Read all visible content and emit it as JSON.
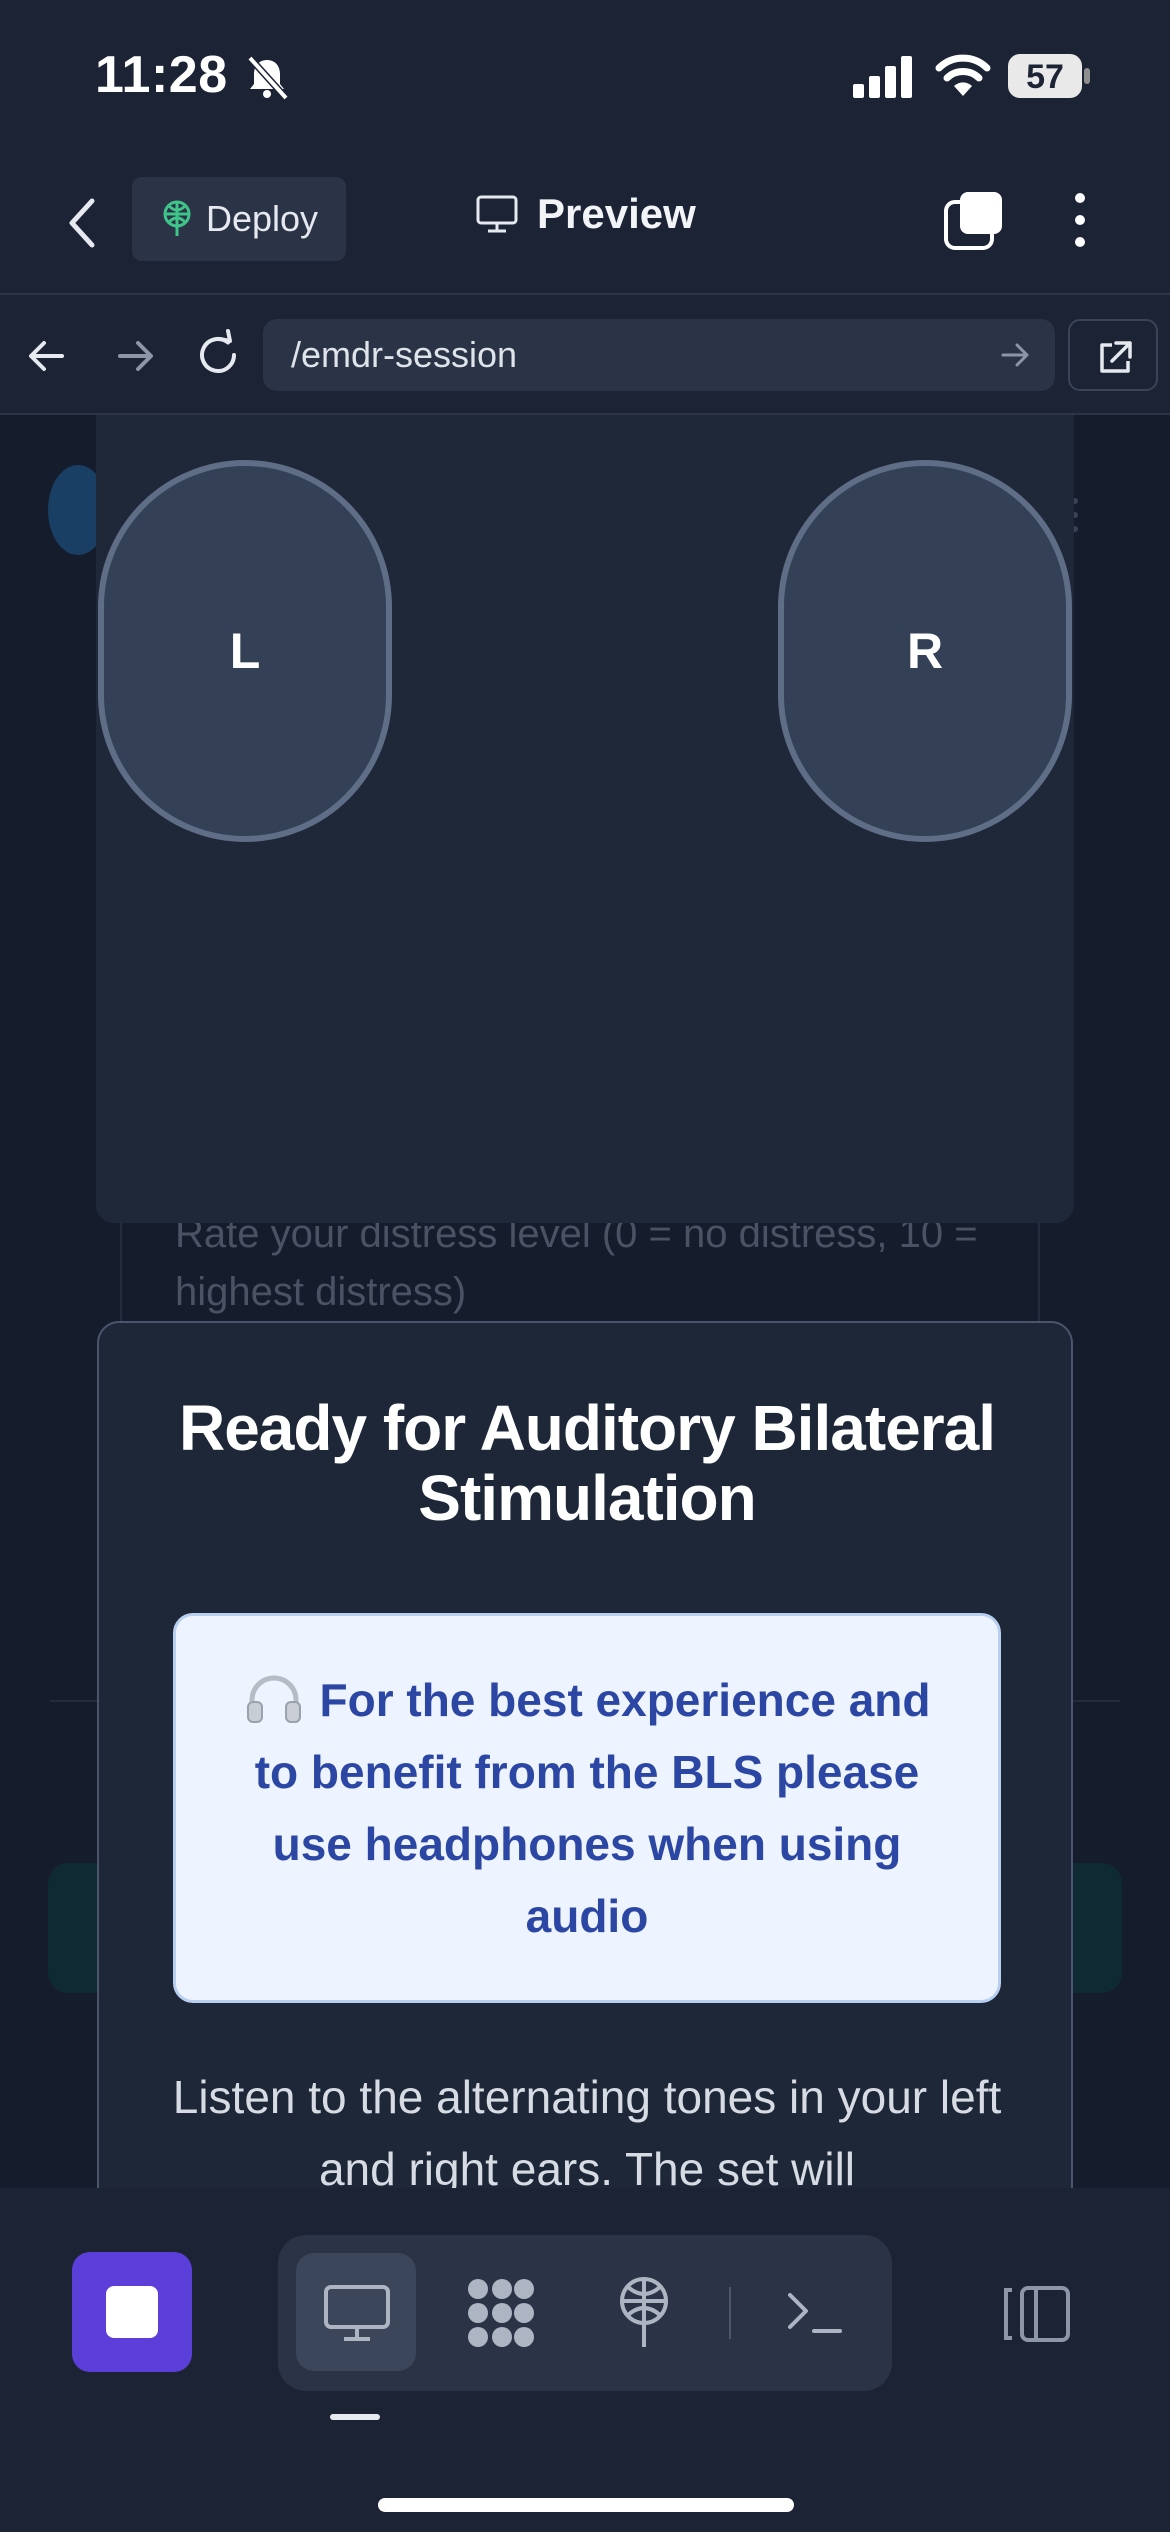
{
  "status_bar": {
    "time": "11:28",
    "battery": "57",
    "icons": [
      "bell-muted-icon",
      "signal-icon",
      "wifi-icon",
      "battery-icon"
    ]
  },
  "header": {
    "deploy_label": "Deploy",
    "preview_label": "Preview",
    "icons": [
      "back-chevron-icon",
      "deploy-icon",
      "monitor-icon",
      "tabs-icon",
      "more-vertical-icon"
    ]
  },
  "browser": {
    "url": "/emdr-session",
    "icons": [
      "arrow-left-icon",
      "arrow-right-icon",
      "reload-icon",
      "go-arrow-icon",
      "open-external-icon"
    ]
  },
  "page": {
    "background_text": "Rate your distress level (0 = no distress, 10 = highest distress)",
    "left_ear_label": "L",
    "right_ear_label": "R"
  },
  "modal": {
    "title": "Ready for Auditory Bilateral Stimulation",
    "tip_icon": "headphones-icon",
    "tip": "For the best experience and to benefit from the BLS please use headphones when using audio",
    "description": "Listen to the alternating tones in your left and right ears. The set will"
  },
  "toolbar": {
    "icons": [
      "stop-icon",
      "monitor-icon",
      "grid-icon",
      "deploy-icon",
      "terminal-icon",
      "panel-icon"
    ]
  },
  "colors": {
    "background": "#1b2335",
    "accent": "#5b3fd8",
    "tip_background": "#edf4ff",
    "tip_text": "#2c46a4",
    "deploy_green": "#3fc48a"
  }
}
